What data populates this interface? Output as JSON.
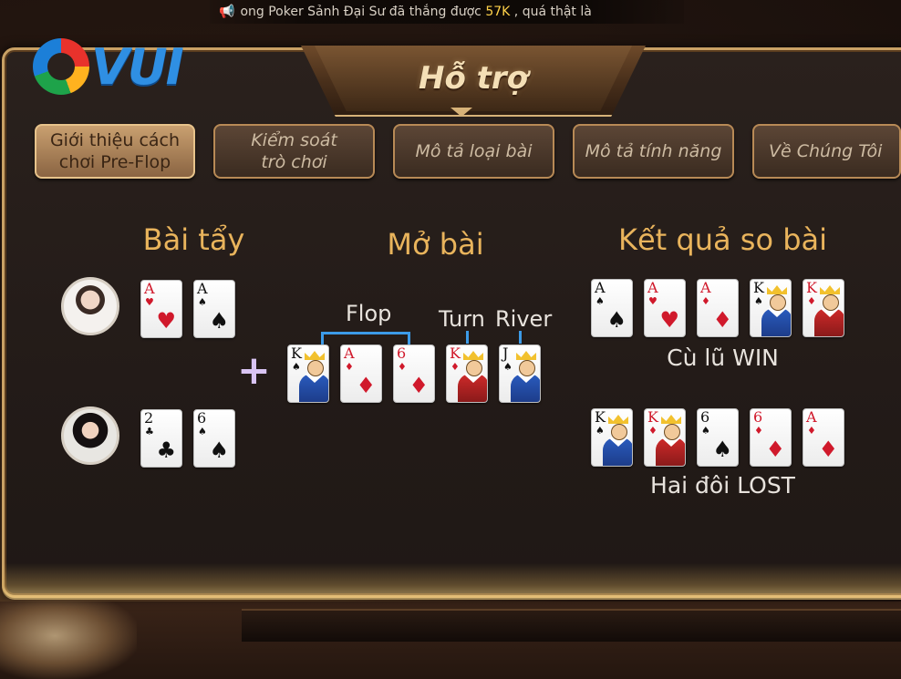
{
  "ticker": {
    "text": "ong Poker Sảnh Đại Sư đã thắng được ",
    "amount": "57K",
    "suffix": " ,  quá thật là"
  },
  "logo": {
    "text": "VUI"
  },
  "title": "Hỗ trợ",
  "tabs": [
    {
      "label": "Giới thiệu cách\nchơi Pre-Flop",
      "active": true
    },
    {
      "label": "Kiểm soát\ntrò chơi",
      "active": false
    },
    {
      "label": "Mô tả loại bài",
      "active": false
    },
    {
      "label": "Mô tả tính năng",
      "active": false
    },
    {
      "label": "Về Chúng Tôi",
      "active": false
    }
  ],
  "headings": {
    "hole": "Bài tẩy",
    "board": "Mở bài",
    "result": "Kết quả so bài"
  },
  "labels": {
    "flop": "Flop",
    "turn": "Turn",
    "river": "River"
  },
  "players": [
    {
      "avatar": "female-avatar-1",
      "cards": [
        {
          "rank": "A",
          "suit": "♥",
          "color": "red"
        },
        {
          "rank": "A",
          "suit": "♠",
          "color": "black"
        }
      ]
    },
    {
      "avatar": "female-avatar-2",
      "cards": [
        {
          "rank": "2",
          "suit": "♣",
          "color": "black"
        },
        {
          "rank": "6",
          "suit": "♠",
          "color": "black"
        }
      ]
    }
  ],
  "board": [
    {
      "rank": "K",
      "suit": "♠",
      "color": "black",
      "face": true,
      "robe": "blue"
    },
    {
      "rank": "A",
      "suit": "♦",
      "color": "red",
      "face": false
    },
    {
      "rank": "6",
      "suit": "♦",
      "color": "red",
      "face": false
    },
    {
      "rank": "K",
      "suit": "♦",
      "color": "red",
      "face": true,
      "robe": "redb"
    },
    {
      "rank": "J",
      "suit": "♠",
      "color": "black",
      "face": true,
      "robe": "blue"
    }
  ],
  "results": [
    {
      "cards": [
        {
          "rank": "A",
          "suit": "♠",
          "color": "black",
          "face": false
        },
        {
          "rank": "A",
          "suit": "♥",
          "color": "red",
          "face": false
        },
        {
          "rank": "A",
          "suit": "♦",
          "color": "red",
          "face": false
        },
        {
          "rank": "K",
          "suit": "♠",
          "color": "black",
          "face": true,
          "robe": "blue"
        },
        {
          "rank": "K",
          "suit": "♦",
          "color": "red",
          "face": true,
          "robe": "redb"
        }
      ],
      "text": "Cù lũ WIN"
    },
    {
      "cards": [
        {
          "rank": "K",
          "suit": "♠",
          "color": "black",
          "face": true,
          "robe": "blue"
        },
        {
          "rank": "K",
          "suit": "♦",
          "color": "red",
          "face": true,
          "robe": "redb"
        },
        {
          "rank": "6",
          "suit": "♠",
          "color": "black",
          "face": false
        },
        {
          "rank": "6",
          "suit": "♦",
          "color": "red",
          "face": false
        },
        {
          "rank": "A",
          "suit": "♦",
          "color": "red",
          "face": false
        }
      ],
      "text": "Hai đôi LOST"
    }
  ]
}
